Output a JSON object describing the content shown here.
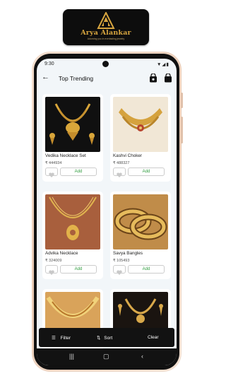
{
  "logo": {
    "name": "Arya Alankar",
    "tagline": "Adorning you in everlasting jewelry"
  },
  "status_bar": {
    "time": "9:30",
    "icons": "▼◢▮"
  },
  "app_bar": {
    "title": "Top Trending",
    "icons": [
      "back-arrow-icon",
      "shopping-bag-icon",
      "lock-bag-icon"
    ]
  },
  "products": [
    {
      "name": "Vedika Necklace Set",
      "price": "₹ 444934",
      "add_label": "Add"
    },
    {
      "name": "Kashvi Choker",
      "price": "₹ 488327",
      "add_label": "Add"
    },
    {
      "name": "Advika Necklace",
      "price": "₹ 324009",
      "add_label": "Add"
    },
    {
      "name": "Savya Bangles",
      "price": "₹ 105493",
      "add_label": "Add"
    },
    {
      "name": "",
      "price": "",
      "add_label": ""
    },
    {
      "name": "",
      "price": "",
      "add_label": ""
    }
  ],
  "filter_bar": {
    "filter_label": "Filter",
    "sort_label": "Sort",
    "clear_label": "Clear"
  },
  "nav_bar": {
    "icons": [
      "recent-apps-icon",
      "home-icon",
      "back-icon"
    ]
  },
  "colors": {
    "accent_green": "#2e9c3d",
    "gold": "#d7a53f",
    "dark": "#121212"
  }
}
